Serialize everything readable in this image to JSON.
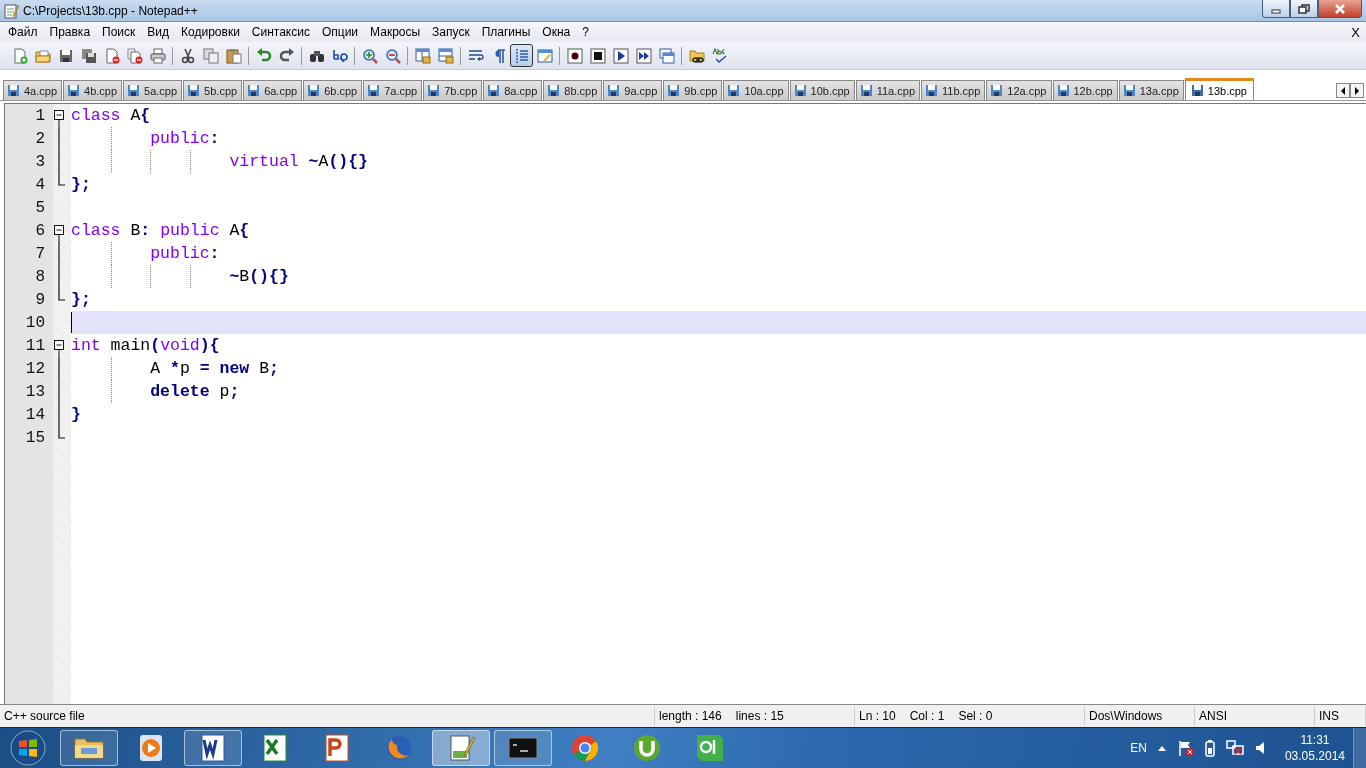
{
  "window": {
    "title": "C:\\Projects\\13b.cpp - Notepad++"
  },
  "menu": {
    "items": [
      "Файл",
      "Правка",
      "Поиск",
      "Вид",
      "Кодировки",
      "Синтаксис",
      "Опции",
      "Макросы",
      "Запуск",
      "Плагины",
      "Окна",
      "?"
    ],
    "close_glyph": "X"
  },
  "toolbar": {
    "buttons": [
      {
        "kind": "new",
        "pressed": false
      },
      {
        "kind": "open",
        "pressed": false
      },
      {
        "kind": "save",
        "pressed": false
      },
      {
        "kind": "save-all",
        "pressed": false
      },
      {
        "kind": "close",
        "pressed": false
      },
      {
        "kind": "close-all",
        "pressed": false
      },
      {
        "kind": "print",
        "pressed": false
      },
      {
        "kind": "separator"
      },
      {
        "kind": "cut",
        "pressed": false
      },
      {
        "kind": "copy",
        "pressed": false
      },
      {
        "kind": "paste",
        "pressed": false
      },
      {
        "kind": "separator"
      },
      {
        "kind": "undo",
        "pressed": false
      },
      {
        "kind": "redo",
        "pressed": false
      },
      {
        "kind": "separator"
      },
      {
        "kind": "find",
        "pressed": false
      },
      {
        "kind": "replace",
        "pressed": false
      },
      {
        "kind": "separator"
      },
      {
        "kind": "zoom-in",
        "pressed": false
      },
      {
        "kind": "zoom-out",
        "pressed": false
      },
      {
        "kind": "separator"
      },
      {
        "kind": "sync-vertical",
        "pressed": false
      },
      {
        "kind": "sync-horizontal",
        "pressed": false
      },
      {
        "kind": "separator"
      },
      {
        "kind": "wrap",
        "pressed": false
      },
      {
        "kind": "pilcrow",
        "pressed": false
      },
      {
        "kind": "indent-guide",
        "pressed": true
      },
      {
        "kind": "panel",
        "pressed": false
      },
      {
        "kind": "separator"
      },
      {
        "kind": "record",
        "pressed": false
      },
      {
        "kind": "stop",
        "pressed": false
      },
      {
        "kind": "play",
        "pressed": false
      },
      {
        "kind": "play-multiple",
        "pressed": false
      },
      {
        "kind": "save-macro",
        "pressed": false
      },
      {
        "kind": "separator"
      },
      {
        "kind": "folder-link"
      },
      {
        "kind": "spellcheck"
      }
    ]
  },
  "tabs": [
    {
      "label": "4a.cpp",
      "selected": false
    },
    {
      "label": "4b.cpp",
      "selected": false
    },
    {
      "label": "5a.cpp",
      "selected": false
    },
    {
      "label": "5b.cpp",
      "selected": false
    },
    {
      "label": "6a.cpp",
      "selected": false
    },
    {
      "label": "6b.cpp",
      "selected": false
    },
    {
      "label": "7a.cpp",
      "selected": false
    },
    {
      "label": "7b.cpp",
      "selected": false
    },
    {
      "label": "8a.cpp",
      "selected": false
    },
    {
      "label": "8b.cpp",
      "selected": false
    },
    {
      "label": "9a.cpp",
      "selected": false
    },
    {
      "label": "9b.cpp",
      "selected": false
    },
    {
      "label": "10a.cpp",
      "selected": false
    },
    {
      "label": "10b.cpp",
      "selected": false
    },
    {
      "label": "11a.cpp",
      "selected": false
    },
    {
      "label": "11b.cpp",
      "selected": false
    },
    {
      "label": "12a.cpp",
      "selected": false
    },
    {
      "label": "12b.cpp",
      "selected": false
    },
    {
      "label": "13a.cpp",
      "selected": false
    },
    {
      "label": "13b.cpp",
      "selected": true
    }
  ],
  "editor": {
    "lines": [
      {
        "number": "1",
        "fold_start": true,
        "fold_body": false,
        "fold_end": false,
        "current": false,
        "tokens": [
          {
            "kind": "type",
            "text": "class"
          },
          {
            "kind": "plain",
            "text": " A"
          },
          {
            "kind": "operator",
            "text": "{"
          }
        ]
      },
      {
        "number": "2",
        "fold_start": false,
        "fold_body": true,
        "fold_end": false,
        "current": false,
        "tokens": [
          {
            "kind": "type",
            "text": "\t\tpublic"
          },
          {
            "kind": "operator",
            "text": ":"
          }
        ]
      },
      {
        "number": "3",
        "fold_start": false,
        "fold_body": true,
        "fold_end": false,
        "current": false,
        "tokens": [
          {
            "kind": "type",
            "text": "\t\t\t\tvirtual"
          },
          {
            "kind": "operator",
            "text": " ~"
          },
          {
            "kind": "plain",
            "text": "A"
          },
          {
            "kind": "operator",
            "text": "(){}"
          }
        ]
      },
      {
        "number": "4",
        "fold_start": false,
        "fold_body": false,
        "fold_end": true,
        "current": false,
        "tokens": [
          {
            "kind": "operator",
            "text": "};"
          }
        ]
      },
      {
        "number": "5",
        "fold_start": false,
        "fold_body": false,
        "fold_end": false,
        "current": false
      },
      {
        "number": "6",
        "fold_start": true,
        "fold_body": false,
        "fold_end": false,
        "current": false,
        "tokens": [
          {
            "kind": "type",
            "text": "class"
          },
          {
            "kind": "plain",
            "text": " B"
          },
          {
            "kind": "operator",
            "text": ":"
          },
          {
            "kind": "type",
            "text": " public"
          },
          {
            "kind": "plain",
            "text": " A"
          },
          {
            "kind": "operator",
            "text": "{"
          }
        ]
      },
      {
        "number": "7",
        "fold_start": false,
        "fold_body": true,
        "fold_end": false,
        "current": false,
        "tokens": [
          {
            "kind": "type",
            "text": "\t\tpublic"
          },
          {
            "kind": "operator",
            "text": ":"
          }
        ]
      },
      {
        "number": "8",
        "fold_start": false,
        "fold_body": true,
        "fold_end": false,
        "current": false,
        "tokens": [
          {
            "kind": "operator",
            "text": "\t\t\t\t~"
          },
          {
            "kind": "plain",
            "text": "B"
          },
          {
            "kind": "operator",
            "text": "(){}"
          }
        ]
      },
      {
        "number": "9",
        "fold_start": false,
        "fold_body": false,
        "fold_end": true,
        "current": false,
        "tokens": [
          {
            "kind": "operator",
            "text": "};"
          }
        ]
      },
      {
        "number": "10",
        "fold_start": false,
        "fold_body": false,
        "fold_end": false,
        "current": true
      },
      {
        "number": "11",
        "fold_start": true,
        "fold_body": false,
        "fold_end": false,
        "current": false,
        "tokens": [
          {
            "kind": "type",
            "text": "int"
          },
          {
            "kind": "plain",
            "text": " main"
          },
          {
            "kind": "operator",
            "text": "("
          },
          {
            "kind": "type",
            "text": "void"
          },
          {
            "kind": "operator",
            "text": "){"
          }
        ]
      },
      {
        "number": "12",
        "fold_start": false,
        "fold_body": true,
        "fold_end": false,
        "current": false,
        "tokens": [
          {
            "kind": "plain",
            "text": "\t\tA "
          },
          {
            "kind": "operator",
            "text": "*"
          },
          {
            "kind": "plain",
            "text": "p "
          },
          {
            "kind": "operator",
            "text": "="
          },
          {
            "kind": "instruction",
            "text": " new"
          },
          {
            "kind": "plain",
            "text": " B"
          },
          {
            "kind": "operator",
            "text": ";"
          }
        ]
      },
      {
        "number": "13",
        "fold_start": false,
        "fold_body": true,
        "fold_end": false,
        "current": false,
        "tokens": [
          {
            "kind": "instruction",
            "text": "\t\tdelete"
          },
          {
            "kind": "plain",
            "text": " p"
          },
          {
            "kind": "operator",
            "text": ";"
          }
        ]
      },
      {
        "number": "14",
        "fold_start": false,
        "fold_body": true,
        "fold_end": false,
        "current": false,
        "tokens": [
          {
            "kind": "operator",
            "text": "}"
          }
        ]
      },
      {
        "number": "15",
        "fold_start": false,
        "fold_body": false,
        "fold_end": true,
        "current": false
      }
    ]
  },
  "status_bar": {
    "sections": [
      [
        "C++ source file"
      ],
      [
        "length : 146",
        "lines : 15"
      ],
      [
        "Ln : 10",
        "Col : 1",
        "Sel : 0"
      ],
      [
        "Dos\\Windows"
      ],
      [
        "ANSI"
      ],
      [
        "INS"
      ]
    ]
  },
  "taskbar": {
    "apps": [
      {
        "kind": "explorer",
        "running": true,
        "active": false
      },
      {
        "kind": "media-player",
        "running": false,
        "active": false
      },
      {
        "kind": "word",
        "running": true,
        "active": false
      },
      {
        "kind": "excel",
        "running": false,
        "active": false
      },
      {
        "kind": "powerpoint",
        "running": false,
        "active": false
      },
      {
        "kind": "firefox",
        "running": false,
        "active": false
      },
      {
        "kind": "notepad",
        "running": true,
        "active": true
      },
      {
        "kind": "console",
        "running": true,
        "active": false
      },
      {
        "kind": "chrome",
        "running": false,
        "active": false
      },
      {
        "kind": "torrent",
        "running": false,
        "active": false
      },
      {
        "kind": "qt",
        "running": false,
        "active": false
      }
    ],
    "language": "EN",
    "time": "11:31",
    "date": "03.05.2014"
  }
}
